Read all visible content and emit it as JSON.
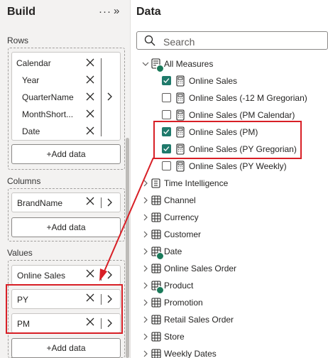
{
  "build": {
    "title": "Build",
    "more": "···",
    "collapse": "»",
    "rows_label": "Rows",
    "rows": [
      "Calendar",
      "Year",
      "QuarterName",
      "MonthShort...",
      "Date"
    ],
    "columns_label": "Columns",
    "columns": [
      "BrandName"
    ],
    "values_label": "Values",
    "values": [
      "Online Sales",
      "PY",
      "PM"
    ],
    "add_data": "+Add data"
  },
  "data_pane": {
    "title": "Data",
    "search_placeholder": "Search",
    "all_measures": "All Measures",
    "measures": [
      {
        "label": "Online Sales",
        "checked": true
      },
      {
        "label": "Online Sales (-12 M Gregorian)",
        "checked": false
      },
      {
        "label": "Online Sales (PM Calendar)",
        "checked": false
      },
      {
        "label": "Online Sales (PM)",
        "checked": true
      },
      {
        "label": "Online Sales (PY Gregorian)",
        "checked": true
      },
      {
        "label": "Online Sales (PY Weekly)",
        "checked": false
      }
    ],
    "time_intelligence": "Time Intelligence",
    "tables": [
      "Channel",
      "Currency",
      "Customer",
      "Date",
      "Online Sales Order",
      "Product",
      "Promotion",
      "Retail Sales Order",
      "Store",
      "Weekly Dates"
    ]
  },
  "colors": {
    "highlight": "#d81f26",
    "checkbox_checked": "#1f7a6b",
    "badge": "#1a7a5a"
  }
}
